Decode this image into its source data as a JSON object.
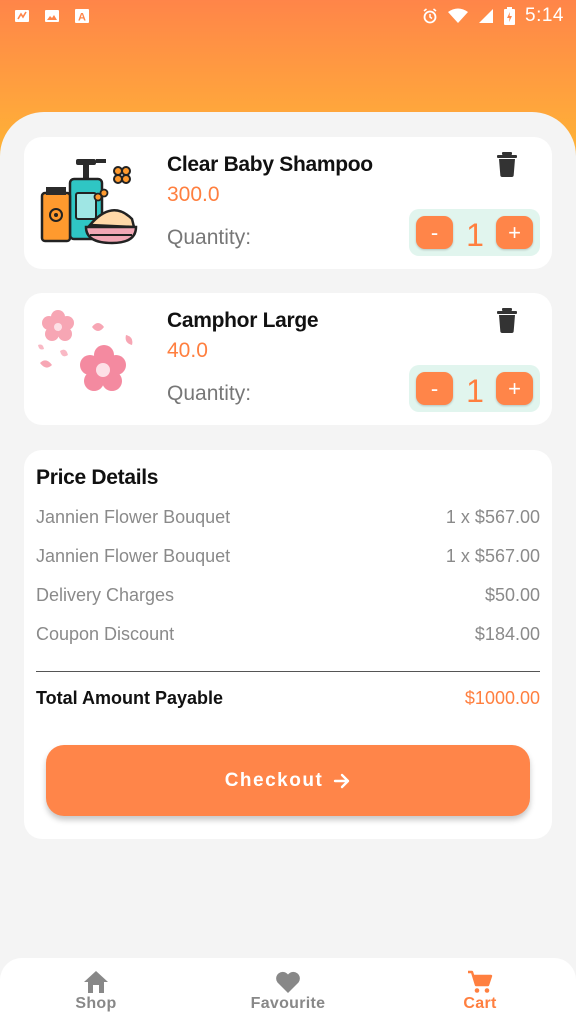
{
  "status_bar": {
    "time": "5:14",
    "left_icons": [
      "notification-icon",
      "image-icon",
      "a-icon"
    ],
    "right_icons": [
      "alarm-icon",
      "wifi-icon",
      "signal-icon",
      "battery-icon"
    ]
  },
  "cart": {
    "items": [
      {
        "name": "Clear Baby Shampoo",
        "price": "300.0",
        "quantity_label": "Quantity:",
        "quantity": "1",
        "minus": "-",
        "plus": "+",
        "image_icon": "shampoo-cosmetics-icon"
      },
      {
        "name": "Camphor Large",
        "price": "40.0",
        "quantity_label": "Quantity:",
        "quantity": "1",
        "minus": "-",
        "plus": "+",
        "image_icon": "pink-flowers-icon"
      }
    ]
  },
  "price_details": {
    "title": "Price Details",
    "rows": [
      {
        "label": "Jannien Flower Bouquet",
        "value": "1 x $567.00"
      },
      {
        "label": "Jannien Flower Bouquet",
        "value": "1 x $567.00"
      },
      {
        "label": "Delivery Charges",
        "value": "$50.00"
      },
      {
        "label": "Coupon Discount",
        "value": "$184.00"
      }
    ],
    "total_label": "Total Amount Payable",
    "total_value": "$1000.00",
    "checkout_label": "Checkout"
  },
  "nav": {
    "items": [
      {
        "label": "Shop",
        "icon": "home-icon",
        "active": false
      },
      {
        "label": "Favourite",
        "icon": "heart-icon",
        "active": false
      },
      {
        "label": "Cart",
        "icon": "cart-icon",
        "active": true
      }
    ]
  },
  "colors": {
    "accent": "#ff8549",
    "header_top": "#ff8549",
    "header_bottom": "#fcc02e",
    "stepper_bg": "#e1f5ee"
  }
}
